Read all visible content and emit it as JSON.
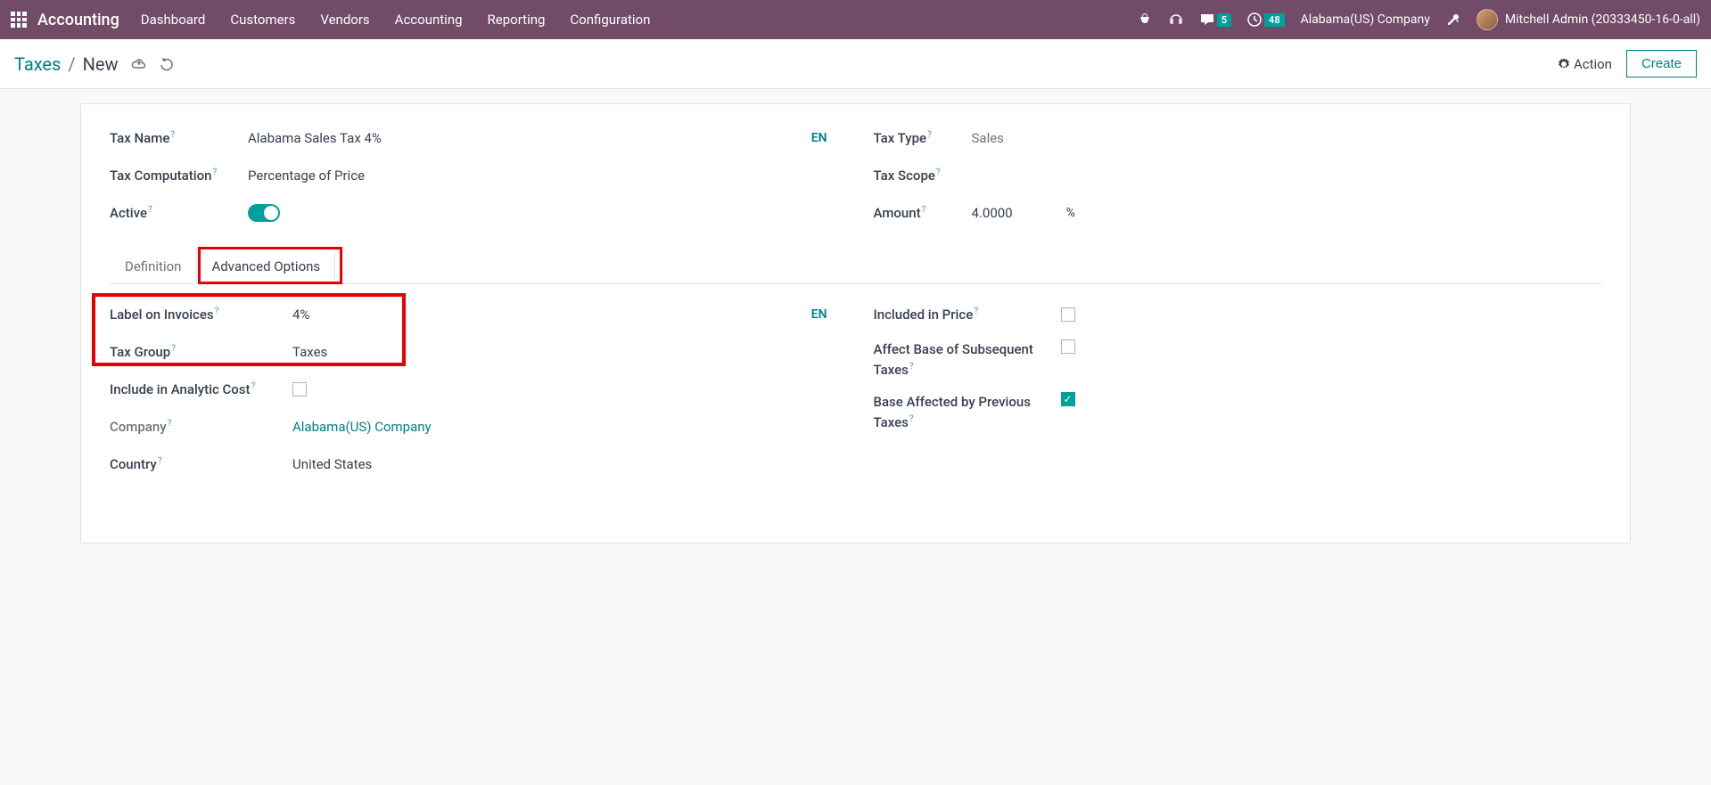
{
  "navbar": {
    "brand": "Accounting",
    "menu": [
      "Dashboard",
      "Customers",
      "Vendors",
      "Accounting",
      "Reporting",
      "Configuration"
    ],
    "chat_count": "5",
    "activity_count": "48",
    "company": "Alabama(US) Company",
    "user": "Mitchell Admin (20333450-16-0-all)"
  },
  "breadcrumb": {
    "root": "Taxes",
    "current": "New"
  },
  "buttons": {
    "action": "Action",
    "create": "Create"
  },
  "form": {
    "tax_name_label": "Tax Name",
    "tax_name_value": "Alabama Sales Tax 4%",
    "lang": "EN",
    "tax_computation_label": "Tax Computation",
    "tax_computation_value": "Percentage of Price",
    "active_label": "Active",
    "tax_type_label": "Tax Type",
    "tax_type_value": "Sales",
    "tax_scope_label": "Tax Scope",
    "amount_label": "Amount",
    "amount_value": "4.0000",
    "amount_suffix": "%"
  },
  "tabs": {
    "definition": "Definition",
    "advanced": "Advanced Options"
  },
  "advanced": {
    "label_on_invoices_l": "Label on Invoices",
    "label_on_invoices_v": "4%",
    "tax_group_l": "Tax Group",
    "tax_group_v": "Taxes",
    "include_analytic_l": "Include in Analytic Cost",
    "company_l": "Company",
    "company_v": "Alabama(US) Company",
    "country_l": "Country",
    "country_v": "United States",
    "included_in_price_l": "Included in Price",
    "affect_base_l": "Affect Base of Subsequent Taxes",
    "base_affected_l": "Base Affected by Previous Taxes",
    "lang": "EN"
  }
}
